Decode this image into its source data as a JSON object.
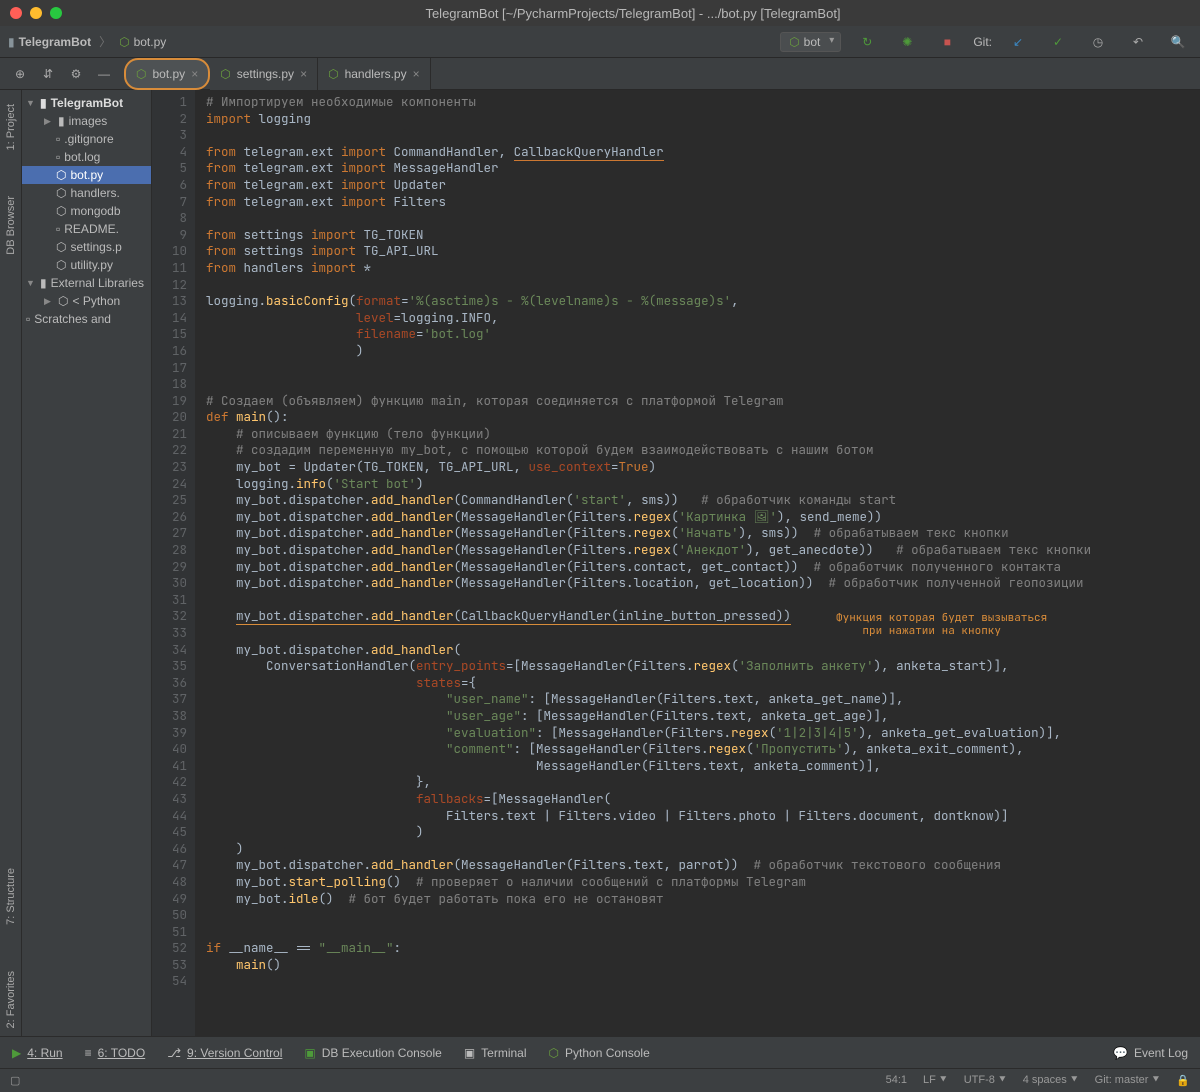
{
  "window_title": "TelegramBot [~/PycharmProjects/TelegramBot] - .../bot.py [TelegramBot]",
  "breadcrumb": {
    "project": "TelegramBot",
    "file": "bot.py"
  },
  "run_config": "bot",
  "git_label": "Git:",
  "tabs": [
    {
      "name": "bot.py",
      "active": true
    },
    {
      "name": "settings.py",
      "active": false
    },
    {
      "name": "handlers.py",
      "active": false
    }
  ],
  "project_tree": {
    "root": "TelegramBot",
    "items": [
      "images",
      ".gitignore",
      "bot.log",
      "bot.py",
      "handlers.",
      "mongodb",
      "README.",
      "settings.p",
      "utility.py"
    ],
    "ext_lib": "External Libraries",
    "python": "< Python",
    "scratches": "Scratches and"
  },
  "side_panels": [
    "1: Project",
    "DB Browser",
    "7: Structure",
    "2: Favorites"
  ],
  "bottom_panels": [
    "4: Run",
    "6: TODO",
    "9: Version Control",
    "DB Execution Console",
    "Terminal",
    "Python Console",
    "Event Log"
  ],
  "status": {
    "pos": "54:1",
    "lf": "LF",
    "enc": "UTF-8",
    "indent": "4 spaces",
    "git": "Git: master"
  },
  "annotation_text_1": "Функция  которая будет вызываться",
  "annotation_text_2": "при нажатии на кнопку",
  "code": [
    "# Импортируем необходимые компоненты",
    "import logging",
    "",
    "from telegram.ext import CommandHandler, CallbackQueryHandler",
    "from telegram.ext import MessageHandler",
    "from telegram.ext import Updater",
    "from telegram.ext import Filters",
    "",
    "from settings import TG_TOKEN",
    "from settings import TG_API_URL",
    "from handlers import *",
    "",
    "logging.basicConfig(format='%(asctime)s - %(levelname)s - %(message)s',",
    "                    level=logging.INFO,",
    "                    filename='bot.log'",
    "                    )",
    "",
    "",
    "# Создаем (объявляем) функцию main, которая соединяется с платформой Telegram",
    "def main():",
    "    # описываем функцию (тело функции)",
    "    # создадим переменную my_bot, с помощью которой будем взаимодействовать с нашим ботом",
    "    my_bot = Updater(TG_TOKEN, TG_API_URL, use_context=True)",
    "    logging.info('Start bot')",
    "    my_bot.dispatcher.add_handler(CommandHandler('start', sms))   # обработчик команды start",
    "    my_bot.dispatcher.add_handler(MessageHandler(Filters.regex('Картинка 🖼'), send_meme))",
    "    my_bot.dispatcher.add_handler(MessageHandler(Filters.regex('Начать'), sms))  # обрабатываем текс кнопки",
    "    my_bot.dispatcher.add_handler(MessageHandler(Filters.regex('Анекдот'), get_anecdote))   # обрабатываем текс кнопки",
    "    my_bot.dispatcher.add_handler(MessageHandler(Filters.contact, get_contact))  # обработчик полученного контакта",
    "    my_bot.dispatcher.add_handler(MessageHandler(Filters.location, get_location))  # обработчик полученной геопозиции",
    "",
    "    my_bot.dispatcher.add_handler(CallbackQueryHandler(inline_button_pressed))",
    "",
    "    my_bot.dispatcher.add_handler(",
    "        ConversationHandler(entry_points=[MessageHandler(Filters.regex('Заполнить анкету'), anketa_start)],",
    "                            states={",
    "                                \"user_name\": [MessageHandler(Filters.text, anketa_get_name)],",
    "                                \"user_age\": [MessageHandler(Filters.text, anketa_get_age)],",
    "                                \"evaluation\": [MessageHandler(Filters.regex('1|2|3|4|5'), anketa_get_evaluation)],",
    "                                \"comment\": [MessageHandler(Filters.regex('Пропустить'), anketa_exit_comment),",
    "                                            MessageHandler(Filters.text, anketa_comment)],",
    "                            },",
    "                            fallbacks=[MessageHandler(",
    "                                Filters.text | Filters.video | Filters.photo | Filters.document, dontknow)]",
    "                            )",
    "    )",
    "    my_bot.dispatcher.add_handler(MessageHandler(Filters.text, parrot))  # обработчик текстового сообщения",
    "    my_bot.start_polling()  # проверяет о наличии сообщений с платформы Telegram",
    "    my_bot.idle()  # бот будет работать пока его не остановят",
    "",
    "",
    "if __name__ == \"__main__\":",
    "    main()",
    ""
  ]
}
